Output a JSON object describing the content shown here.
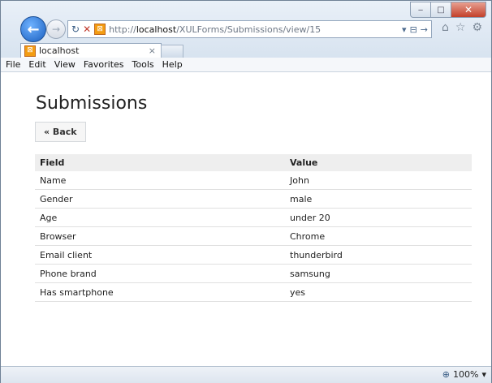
{
  "window": {
    "minimize_label": "‒",
    "maximize_label": "□",
    "close_label": "✕"
  },
  "toolbar": {
    "back_label": "←",
    "forward_label": "→",
    "url_prefix": "http://",
    "url_host": "localhost",
    "url_path": "/XULForms/Submissions/view/15",
    "refresh_icon": "refresh-icon",
    "stop_icon": "stop-icon",
    "home_icon": "home-icon",
    "favorites_icon": "star-icon",
    "tools_icon": "gear-icon"
  },
  "tab": {
    "title": "localhost",
    "close_label": "×"
  },
  "menu": [
    "File",
    "Edit",
    "View",
    "Favorites",
    "Tools",
    "Help"
  ],
  "page": {
    "title": "Submissions",
    "back_label": "« Back"
  },
  "table": {
    "headers": [
      "Field",
      "Value"
    ],
    "rows": [
      [
        "Name",
        "John"
      ],
      [
        "Gender",
        "male"
      ],
      [
        "Age",
        "under 20"
      ],
      [
        "Browser",
        "Chrome"
      ],
      [
        "Email client",
        "thunderbird"
      ],
      [
        "Phone brand",
        "samsung"
      ],
      [
        "Has smartphone",
        "yes"
      ]
    ]
  },
  "status": {
    "zoom": "100%"
  }
}
